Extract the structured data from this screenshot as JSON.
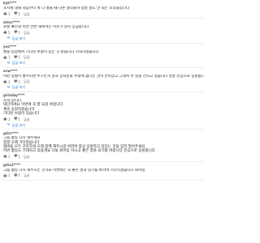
{
  "colors": {
    "link": "#2a6fd6",
    "text": "#222222",
    "meta": "#999999"
  },
  "icons": {
    "like": "thumb-up-icon",
    "dislike": "thumb-down-icon",
    "expand": "chevron-down-icon"
  },
  "comments": [
    {
      "author": "kyk****",
      "time": "",
      "lines": [
        "소시에 대해 처음부터 쭉 다 봤을 때 나온 생각들이 정말 말도 안 되는 소리들입니다"
      ],
      "likes": "1",
      "dislikes": "1",
      "reply_label": "답글",
      "has_replies": false,
      "replies_label": ""
    },
    {
      "author": "shinc****",
      "time": "",
      "lines": [
        "로컬 좋은데 이번 한번 해보려는 이유가 뭔지 궁금합니다"
      ],
      "likes": "5",
      "dislikes": "1",
      "reply_label": "답글",
      "has_replies": true,
      "replies_label": "답글 보기"
    },
    {
      "author": "yes****",
      "time": "",
      "lines": [
        "팬들 입장에서 기다린 보람이 있는 것 같습니다 기대하겠습니다"
      ],
      "likes": "1",
      "dislikes": "1",
      "reply_label": "답글",
      "has_replies": true,
      "replies_label": "답글 보기"
    },
    {
      "author": "ovw****",
      "time": "",
      "lines": [
        "이런 상황이 벌어지면 누구든지 결국 상처받을 수밖에 없다는 것이 안타깝고 그래서 이 말을 전하고 싶습니다 정말 진심으로 응원합니다"
      ],
      "likes": "1",
      "dislikes": "1",
      "reply_label": "답글",
      "has_replies": true,
      "replies_label": "답글 보기"
    },
    {
      "author": "girlsday****",
      "time": "",
      "lines": [
        "소희 입니다",
        "대단하네요 이번에 꼭 잘 되길 바랍니다",
        "계속 응원하겠습니다",
        "기다린 보람이 있습니다"
      ],
      "likes": "1",
      "dislikes": "1",
      "reply_label": "답글",
      "has_replies": true,
      "replies_label": "답글 보기"
    },
    {
      "author": "gdrs****",
      "time": "",
      "lines": [
        "그룹 활동 다시 해주세요",
        "정말 오래 기다렸습니다",
        "멤버들 모두 건강하게 오래 함께 해주시길 바라며 항상 응원하고 있다는 것을 잊지 말아주세요",
        "이번 활동도 기대하고 있을게요 다들 화이팅 하시고 좋은 결과 있기를 바랍니다 진심으로 응원합니다"
      ],
      "likes": "2",
      "dislikes": "1",
      "reply_label": "답글",
      "has_replies": false,
      "replies_label": ""
    },
    {
      "author": "gdrs2****",
      "time": "",
      "lines": [
        "그룹 활동 다시 해주시는 건가요 이번에는 꼭 좋은 결과 있기를 바라며 기다리겠습니다 화이팅"
      ],
      "likes": "1",
      "dislikes": "1",
      "reply_label": "답글",
      "has_replies": false,
      "replies_label": ""
    }
  ]
}
